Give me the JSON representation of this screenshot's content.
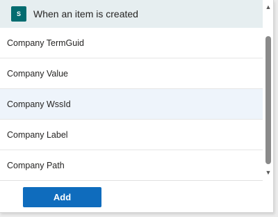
{
  "header": {
    "icon": "sharepoint-icon",
    "icon_color": "#036c70",
    "icon_text": "S",
    "title": "When an item is created"
  },
  "list": {
    "items": [
      {
        "label": "Company TermGuid"
      },
      {
        "label": "Company Value"
      },
      {
        "label": "Company WssId"
      },
      {
        "label": "Company Label"
      },
      {
        "label": "Company Path"
      }
    ]
  },
  "footer": {
    "add_label": "Add",
    "add_color": "#0f6cbd"
  }
}
